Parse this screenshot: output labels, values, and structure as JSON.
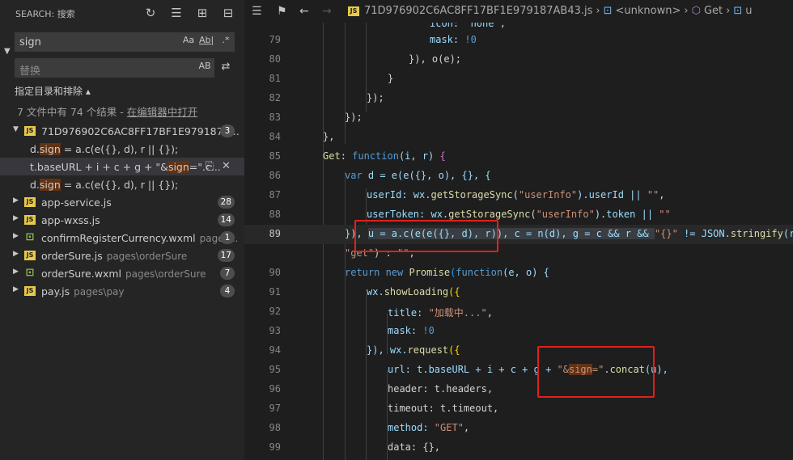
{
  "sidebar": {
    "title": "SEARCH: 搜索",
    "search_value": "sign",
    "match_case": "Aa",
    "whole_word": "Ab|",
    "regex": ".*",
    "replace_placeholder": "替换",
    "preserve_case": "AB",
    "filter_toggle": "指定目录和排除 ▴",
    "results_prefix": "7 文件中有 74 个结果 - ",
    "results_link": "在编辑器中打开",
    "files": [
      {
        "name": "71D976902C6AC8FF17BF1E979187A...",
        "path": "",
        "count": "3",
        "expanded": true,
        "matches": [
          {
            "pre": "d.",
            "hit": "sign",
            "post": " = a.c(e({}, d), r || {});"
          },
          {
            "pre": "t.baseURL + i + c + g + \"&",
            "hit": "sign",
            "post": "=\".c..."
          },
          {
            "pre": "d.",
            "hit": "sign",
            "post": " = a.c(e({}, d), r || {});"
          }
        ]
      },
      {
        "name": "app-service.js",
        "path": "",
        "count": "28"
      },
      {
        "name": "app-wxss.js",
        "path": "",
        "count": "14"
      },
      {
        "name": "confirmRegisterCurrency.wxml",
        "path": "pages...",
        "count": "1"
      },
      {
        "name": "orderSure.js",
        "path": "pages\\orderSure",
        "count": "17"
      },
      {
        "name": "orderSure.wxml",
        "path": "pages\\orderSure",
        "count": "7"
      },
      {
        "name": "pay.js",
        "path": "pages\\pay",
        "count": "4"
      }
    ]
  },
  "editor": {
    "breadcrumb": {
      "file": "71D976902C6AC8FF17BF1E979187AB43.js",
      "item1": "<unknown>",
      "item2": "Get",
      "item3": "u"
    },
    "line_numbers": [
      "79",
      "80",
      "81",
      "82",
      "83",
      "84",
      "85",
      "86",
      "87",
      "88",
      "89",
      "",
      "90",
      "91",
      "92",
      "93",
      "94",
      "95",
      "96",
      "97",
      "98",
      "99"
    ],
    "code": {
      "l78": "icon: \"none\",",
      "l79a": "mask: ",
      "l79b": "!0",
      "l80": "}), o(e);",
      "l81": "}",
      "l82": "});",
      "l83": "});",
      "l84": "},",
      "l85a": "Get",
      "l85b": ": ",
      "l85c": "function",
      "l85d": "(i, r) ",
      "l86a": "var ",
      "l86b": "d = e(e({}, o), {}, {",
      "l87a": "userId: ",
      "l87b": "wx.",
      "l87c": "getStorageSync",
      "l87d": "(",
      "l87e": "\"userInfo\"",
      "l87f": ").userId || ",
      "l87g": "\"\"",
      "l87h": ",",
      "l88a": "userToken: ",
      "l88b": "wx.",
      "l88c": "getStorageSync",
      "l88d": "(",
      "l88e": "\"userInfo\"",
      "l88f": ").token || ",
      "l88g": "\"\"",
      "l89a": "}), ",
      "l89b": "u = a.c(e(e({}, d), r)), c = n(d), g = c && r && ",
      "l89c": "\"{}\"",
      "l89d": " != JSON.",
      "l89e": "stringify",
      "l89f": "(r) ? ",
      "l89g": "\"&\"",
      "l89x1": "\"get\"",
      "l89x2": ") : ",
      "l89x3": "\"\"",
      "l89x4": ";",
      "l90a": "return ",
      "l90b": "new ",
      "l90c": "Promise",
      "l90d": "(",
      "l90e": "function",
      "l90f": "(e, o) {",
      "l91a": "wx.",
      "l91b": "showLoading",
      "l91c": "({",
      "l92a": "title: ",
      "l92b": "\"加载中...\"",
      "l92c": ",",
      "l93a": "mask: ",
      "l93b": "!0",
      "l94a": "}), wx.",
      "l94b": "request",
      "l94c": "({",
      "l95a": "url: t.baseURL + i + c + g + ",
      "l95b": "\"&",
      "l95c": "sign",
      "l95d": "=\"",
      "l95e": ".",
      "l95f": "concat",
      "l95g": "(u),",
      "l96": "header: t.headers,",
      "l97": "timeout: t.timeout,",
      "l98a": "method: ",
      "l98b": "\"GET\"",
      "l98c": ",",
      "l99": "data: {},"
    }
  },
  "colors": {
    "annotation": "#e0211c",
    "match_bg": "#613214",
    "accent": "#007acc"
  }
}
